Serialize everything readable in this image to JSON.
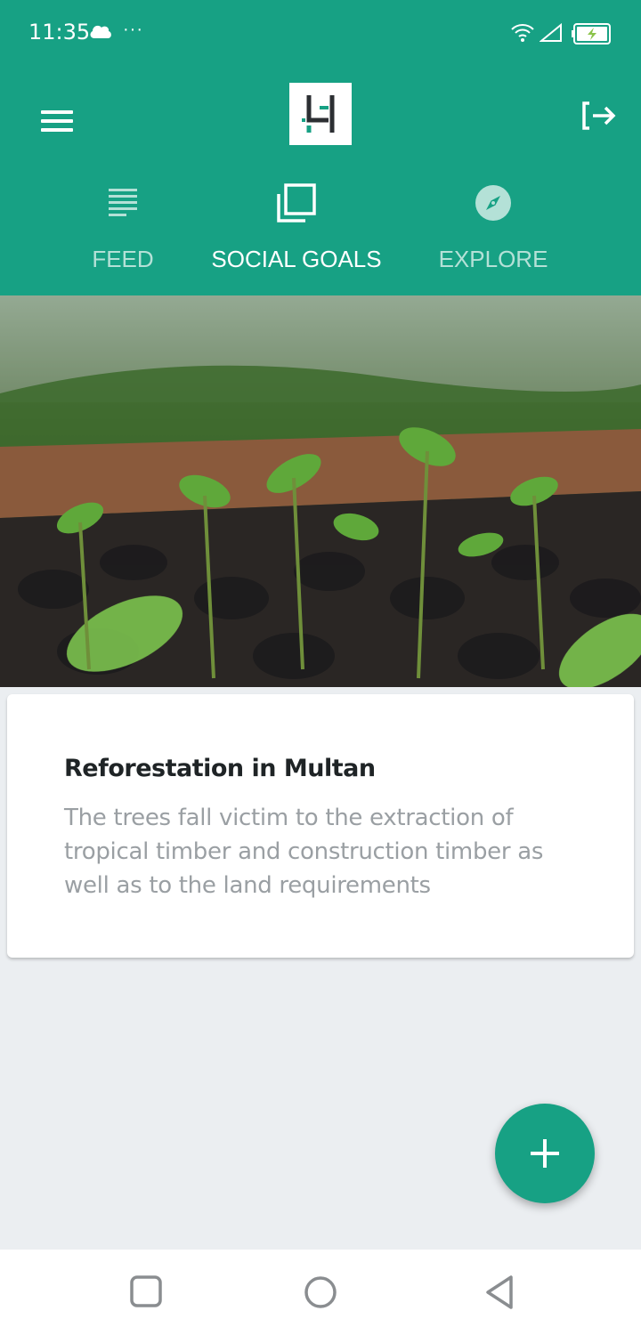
{
  "status_bar": {
    "time": "11:35",
    "icons": [
      "cloud-icon",
      "more-dots-icon",
      "wifi-icon",
      "signal-icon",
      "battery-charging-icon"
    ],
    "dots": "···"
  },
  "app_bar": {
    "menu_icon": "hamburger-menu-icon",
    "logo": "app-logo",
    "logout_icon": "logout-icon"
  },
  "tabs": [
    {
      "label": "FEED",
      "icon": "feed-list-icon",
      "active": false
    },
    {
      "label": "SOCIAL GOALS",
      "icon": "social-goals-icon",
      "active": true
    },
    {
      "label": "EXPLORE",
      "icon": "compass-icon",
      "active": false
    }
  ],
  "goal_card": {
    "image": "tree-seedlings-nursery-photo",
    "title": "Reforestation in Multan",
    "description": "The trees fall victim to the extraction of tropical timber and construction timber as well as to the land requirements"
  },
  "fab": {
    "icon": "plus-icon"
  },
  "nav_bar": {
    "icons": [
      "recent-apps-icon",
      "home-icon",
      "back-icon"
    ]
  },
  "colors": {
    "primary": "#17a184",
    "background": "#ebeef1",
    "card": "#ffffff"
  }
}
